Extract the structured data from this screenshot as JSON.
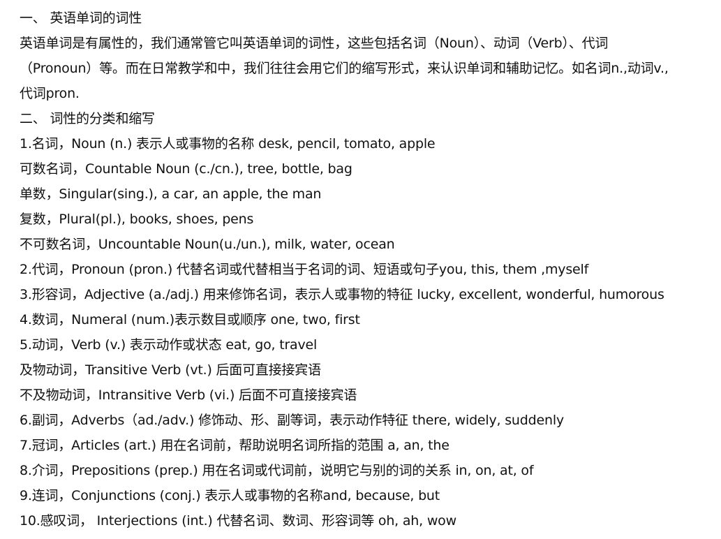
{
  "heading1": "一、 英语单词的词性",
  "intro": [
    "英语单词是有属性的，我们通常管它叫英语单词的词性，这些包括名词（Noun）、动词（Verb）、代词",
    "（Pronoun）等。而在日常教学和中，我们往往会用它们的缩写形式，来认识单词和辅助记忆。如名词n.,动词v.,",
    "代词pron."
  ],
  "heading2": "二、 词性的分类和缩写",
  "items": [
    "1.名词，Noun (n.) 表示人或事物的名称 desk, pencil, tomato, apple",
    "可数名词，Countable Noun (c./cn.), tree, bottle, bag",
    "单数，Singular(sing.), a car, an apple, the man",
    "复数，Plural(pl.), books, shoes, pens",
    "不可数名词，Uncountable Noun(u./un.), milk, water, ocean",
    "2.代词，Pronoun (pron.) 代替名词或代替相当于名词的词、短语或句子you, this, them ,myself",
    "3.形容词，Adjective (a./adj.) 用来修饰名词，表示人或事物的特征 lucky, excellent, wonderful, humorous",
    "4.数词，Numeral (num.)表示数目或顺序 one, two, first",
    "5.动词，Verb (v.) 表示动作或状态 eat, go, travel",
    "及物动词，Transitive Verb (vt.) 后面可直接接宾语",
    "不及物动词，Intransitive Verb (vi.) 后面不可直接接宾语",
    "6.副词，Adverbs（ad./adv.) 修饰动、形、副等词，表示动作特征 there, widely, suddenly",
    "7.冠词，Articles (art.) 用在名词前，帮助说明名词所指的范围 a, an, the",
    "8.介词，Prepositions (prep.) 用在名词或代词前，说明它与别的词的关系 in, on, at, of",
    "9.连词，Conjunctions (conj.) 表示人或事物的名称and, because, but",
    "10.感叹词， Interjections (int.) 代替名词、数词、形容词等 oh, ah, wow"
  ]
}
